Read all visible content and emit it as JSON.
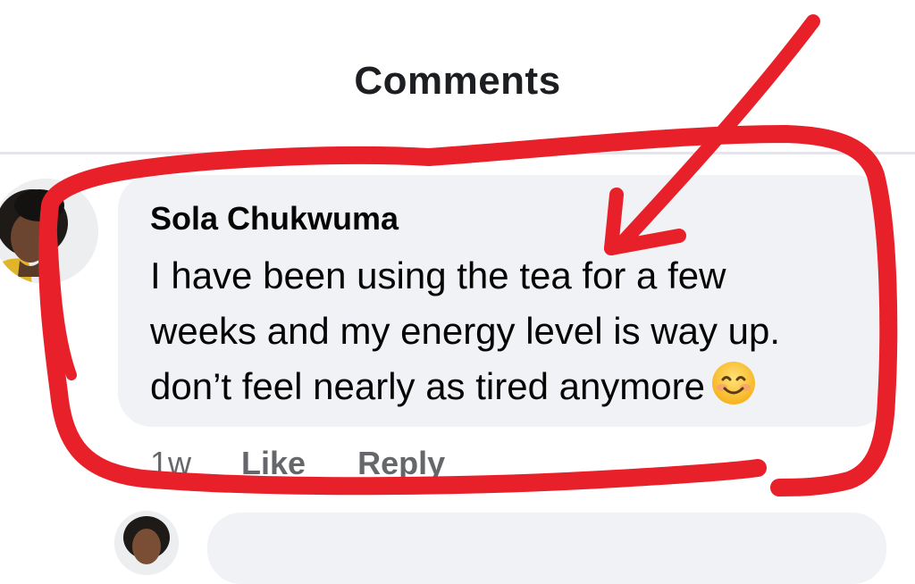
{
  "header": {
    "title": "Comments"
  },
  "comment": {
    "author": "Sola Chukwuma",
    "text_lines": [
      "I have been using the tea for a few",
      "weeks and my energy level is way up.",
      "don’t feel nearly as tired anymore"
    ],
    "emoji": "smiling-face-icon",
    "time": "1w",
    "like_label": "Like",
    "reply_label": "Reply"
  },
  "annotation": {
    "color": "#e8202a",
    "shapes": [
      "hand-drawn-circle",
      "hand-drawn-arrow"
    ]
  },
  "colors": {
    "bubble": "#f0f2f5",
    "meta_text": "#65676b",
    "text": "#050505"
  }
}
